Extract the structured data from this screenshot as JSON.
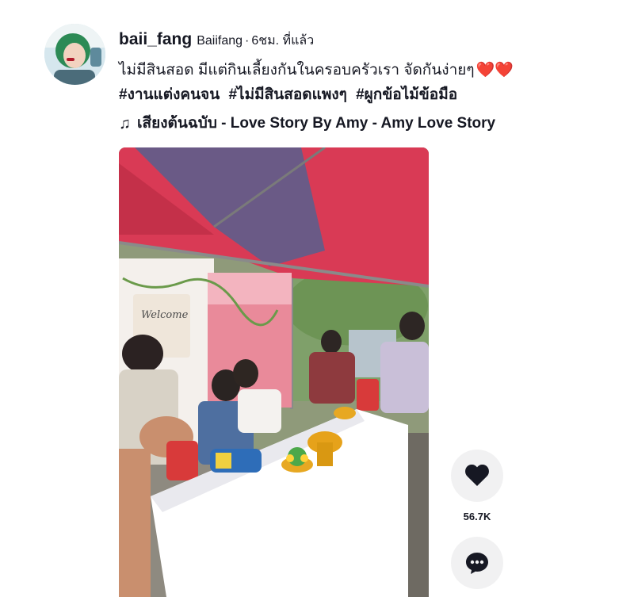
{
  "author": {
    "username": "baii_fang",
    "nickname": "Baiifang",
    "separator": "·",
    "time_ago": "6ชม. ที่แล้ว"
  },
  "caption": {
    "text": "ไม่มีสินสอด มีแต่กินเลี้ยงกันในครอบครัวเรา จัดกันง่ายๆ",
    "hearts": "❤️❤️"
  },
  "hashtags": [
    "#งานแต่งคนจน",
    "#ไม่มีสินสอดแพงๆ",
    "#ผูกข้อไม้ข้อมือ"
  ],
  "music": {
    "icon": "music-note-icon",
    "title": "เสียงต้นฉบับ - Love Story By Amy - Amy Love Story"
  },
  "video": {
    "sign_text": "Welcome"
  },
  "actions": {
    "like_icon": "heart-icon",
    "like_count": "56.7K",
    "comment_icon": "comment-icon"
  },
  "colors": {
    "text": "#161823",
    "action_bg": "#f1f1f2",
    "tent_red": "#d93a55",
    "tent_purple": "#6a5a86"
  }
}
